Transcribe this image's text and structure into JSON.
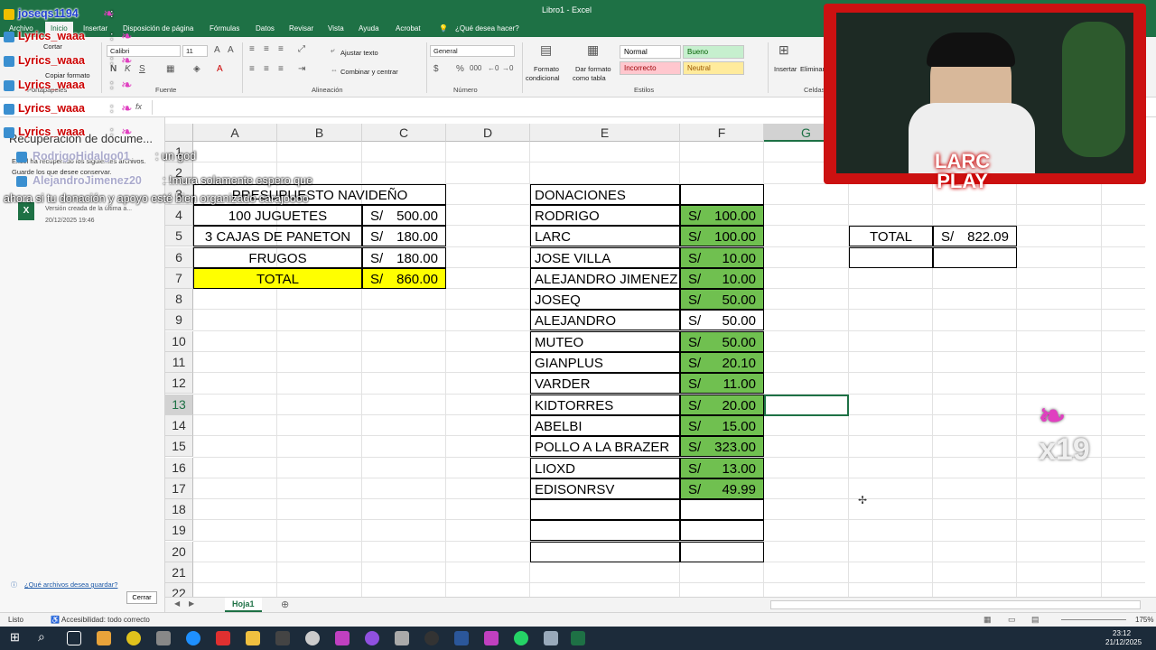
{
  "window": {
    "title": "Libro1 - Excel"
  },
  "ribbon": {
    "tabs": [
      "Archivo",
      "Inicio",
      "Insertar",
      "Disposición de página",
      "Fórmulas",
      "Datos",
      "Revisar",
      "Vista",
      "Ayuda",
      "Acrobat",
      "¿Qué desea hacer?"
    ],
    "font_name": "Calibri",
    "font_size": "11",
    "cut": "Cortar",
    "copy_format": "Copiar formato",
    "wrap": "Ajustar texto",
    "merge": "Combinar y centrar",
    "number_format": "General",
    "cond_format": [
      "Formato",
      "condicional"
    ],
    "table_format": [
      "Dar formato",
      "como tabla"
    ],
    "styles": {
      "normal": "Normal",
      "bueno": "Bueno",
      "incorrecto": "Incorrecto",
      "neutral": "Neutral"
    },
    "insert": "Insertar",
    "delete": "Eliminar",
    "groups": {
      "portapapeles": "Portapapeles",
      "fuente": "Fuente",
      "alineacion": "Alineación",
      "numero": "Número",
      "estilos": "Estilos",
      "celdas": "Celdas"
    }
  },
  "recovery": {
    "title": "Recuperación de docume...",
    "line1": "Excel ha recuperado los siguientes archivos.",
    "line2": "Guarde los que desee conservar.",
    "file_desc": "Versión creada de la última a...",
    "file_date": "20/12/2025 19:46",
    "link": "¿Qué archivos desea guardar?",
    "close": "Cerrar"
  },
  "columns": [
    "A",
    "B",
    "C",
    "D",
    "E",
    "F",
    "G"
  ],
  "rows": [
    "1",
    "2",
    "3",
    "4",
    "5",
    "6",
    "7",
    "8",
    "9",
    "10",
    "11",
    "12",
    "13",
    "14",
    "15",
    "16",
    "17",
    "18",
    "19",
    "20",
    "21",
    "22"
  ],
  "budget": {
    "title": "PRESUPUESTO NAVIDEÑO",
    "items": [
      {
        "label": "100 JUGUETES",
        "cur": "S/",
        "amount": "500.00"
      },
      {
        "label": "3 CAJAS DE PANETON",
        "cur": "S/",
        "amount": "180.00"
      },
      {
        "label": "FRUGOS",
        "cur": "S/",
        "amount": "180.00"
      }
    ],
    "total_label": "TOTAL",
    "total_cur": "S/",
    "total_amount": "860.00"
  },
  "donations": {
    "header": "DONACIONES",
    "rows": [
      {
        "name": "RODRIGO",
        "cur": "S/",
        "amount": "100.00",
        "highlight": true
      },
      {
        "name": "LARC",
        "cur": "S/",
        "amount": "100.00",
        "highlight": true
      },
      {
        "name": "JOSE VILLA",
        "cur": "S/",
        "amount": "10.00",
        "highlight": true
      },
      {
        "name": "ALEJANDRO JIMENEZ",
        "cur": "S/",
        "amount": "10.00",
        "highlight": true
      },
      {
        "name": "JOSEQ",
        "cur": "S/",
        "amount": "50.00",
        "highlight": true
      },
      {
        "name": "ALEJANDRO",
        "cur": "S/",
        "amount": "50.00",
        "highlight": false
      },
      {
        "name": "MUTEO",
        "cur": "S/",
        "amount": "50.00",
        "highlight": true
      },
      {
        "name": "GIANPLUS",
        "cur": "S/",
        "amount": "20.10",
        "highlight": true
      },
      {
        "name": "VARDER",
        "cur": "S/",
        "amount": "11.00",
        "highlight": true
      },
      {
        "name": "KIDTORRES",
        "cur": "S/",
        "amount": "20.00",
        "highlight": true
      },
      {
        "name": "ABELBI",
        "cur": "S/",
        "amount": "15.00",
        "highlight": true
      },
      {
        "name": "POLLO A LA BRAZER",
        "cur": "S/",
        "amount": "323.00",
        "highlight": true
      },
      {
        "name": "LIOXD",
        "cur": "S/",
        "amount": "13.00",
        "highlight": true
      },
      {
        "name": "EDISONRSV",
        "cur": "S/",
        "amount": "49.99",
        "highlight": true
      }
    ]
  },
  "donation_total": {
    "label": "TOTAL",
    "cur": "S/",
    "amount": "822.09"
  },
  "sheet": {
    "tab": "Hoja1"
  },
  "status": {
    "ready": "Listo",
    "accessibility": "Accesibilidad: todo correcto",
    "zoom": "175%"
  },
  "clock": {
    "time": "23:12",
    "date": "21/12/2025"
  },
  "chat": [
    {
      "user": "joseqs1194",
      "sep": ":",
      "msg": ""
    },
    {
      "user": "Lyrics_waaa",
      "sep": ":",
      "msg": ""
    },
    {
      "user": "Lyrics_waaa",
      "sep": ":",
      "msg": ""
    },
    {
      "user": "Lyrics_waaa",
      "sep": ":",
      "msg": ""
    },
    {
      "user": "Lyrics_waaa",
      "sep": ":",
      "msg": ""
    },
    {
      "user": "Lyrics_waaa",
      "sep": ":",
      "msg": ""
    },
    {
      "user": "RodrigoHidalgo01",
      "sep": ":",
      "msg": "un god"
    },
    {
      "user": "AlejandroJimenez20",
      "sep": ":",
      "msg": "!mura solamente espero que"
    },
    {
      "user": "",
      "sep": "",
      "msg": "ahora si tu donación y apoyo esté bien organizado carajoooo"
    }
  ],
  "overlay": {
    "logo_line1": "LARC",
    "logo_line2": "PLAY",
    "combo": "x19"
  },
  "colors": {
    "excel_green": "#1e7145",
    "donation_fill": "#70c050",
    "total_fill": "#ffff00"
  }
}
